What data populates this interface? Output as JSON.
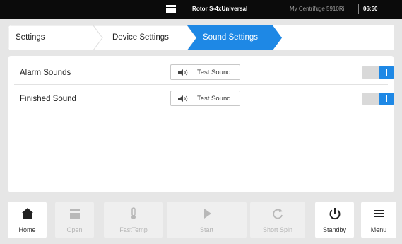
{
  "status_bar": {
    "rotor": "Rotor S-4xUniversal",
    "device": "My Centrifuge 5910Ri",
    "time": "06:50"
  },
  "breadcrumb": {
    "items": [
      {
        "label": "Settings",
        "active": false
      },
      {
        "label": "Device Settings",
        "active": false
      },
      {
        "label": "Sound Settings",
        "active": true
      }
    ],
    "accent": "#1e88e5"
  },
  "settings": {
    "rows": [
      {
        "label": "Alarm Sounds",
        "button": "Test Sound",
        "enabled": true
      },
      {
        "label": "Finished Sound",
        "button": "Test Sound",
        "enabled": true
      }
    ]
  },
  "toolbar": {
    "buttons": [
      {
        "label": "Home",
        "icon": "home-icon",
        "enabled": true
      },
      {
        "label": "Open",
        "icon": "lid-open-icon",
        "enabled": false
      },
      {
        "label": "FastTemp",
        "icon": "thermometer-icon",
        "enabled": false
      },
      {
        "label": "Start",
        "icon": "play-icon",
        "enabled": false
      },
      {
        "label": "Short Spin",
        "icon": "refresh-icon",
        "enabled": false
      },
      {
        "label": "Standby",
        "icon": "power-icon",
        "enabled": true
      },
      {
        "label": "Menu",
        "icon": "hamburger-icon",
        "enabled": true
      }
    ]
  }
}
